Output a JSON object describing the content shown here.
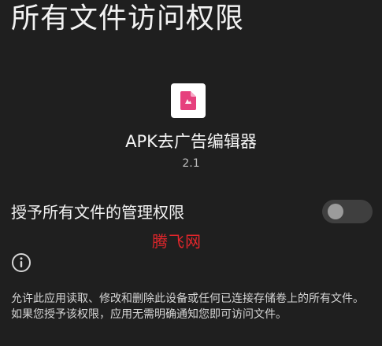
{
  "header": {
    "title": "所有文件访问权限"
  },
  "app": {
    "icon": "document-app-icon",
    "name": "APK去广告编辑器",
    "version": "2.1"
  },
  "permission": {
    "label": "授予所有文件的管理权限",
    "toggle_state": "off"
  },
  "watermark": {
    "text": "腾飞网"
  },
  "info": {
    "icon": "info-icon",
    "description": "允许此应用读取、修改和删除此设备或任何已连接存储卷上的所有文件。如果您授予该权限，应用无需明确通知您即可访问文件。"
  },
  "colors": {
    "background": "#1f1f1f",
    "text": "#f2f2f2",
    "watermark": "#e0262b",
    "toggle_track": "#3f3f3f",
    "toggle_knob": "#9b9b9b",
    "app_icon_accent": "#e6407d"
  }
}
